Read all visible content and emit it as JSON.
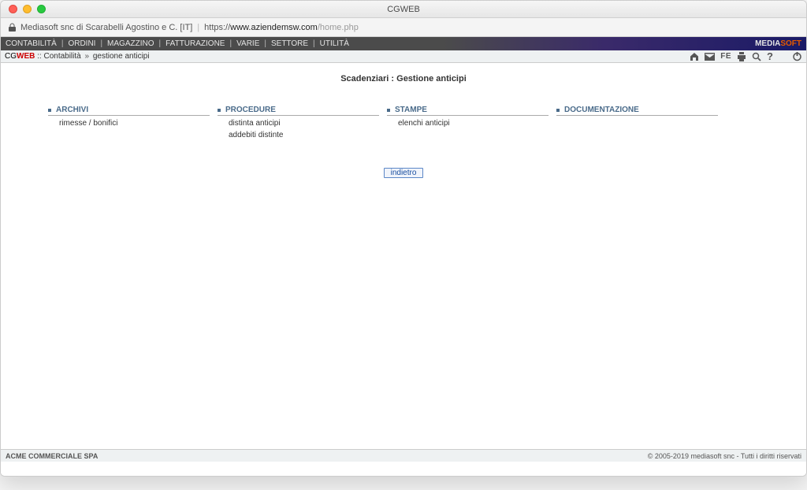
{
  "window": {
    "title": "CGWEB"
  },
  "addressbar": {
    "site_identity": "Mediasoft snc di Scarabelli Agostino e C. [IT]",
    "url_scheme": "https://",
    "url_host": "www.aziendemsw.com",
    "url_path": "/home.php"
  },
  "menubar": {
    "items": [
      "CONTABILITÀ",
      "ORDINI",
      "MAGAZZINO",
      "FATTURAZIONE",
      "VARIE",
      "SETTORE",
      "UTILITÀ"
    ],
    "brand_pre": "MEDIA",
    "brand_post": "SOFT"
  },
  "breadcrumb": {
    "app_pre": "CG",
    "app_post": "WEB",
    "after_app": " :: ",
    "parent": "Contabilità",
    "sep": " » ",
    "current": "gestione anticipi",
    "fe_label": "FE"
  },
  "page": {
    "title": "Scadenziari : Gestione anticipi",
    "back_label": "indietro"
  },
  "columns": [
    {
      "heading": "ARCHIVI",
      "items": [
        "rimesse / bonifici"
      ]
    },
    {
      "heading": "PROCEDURE",
      "items": [
        "distinta anticipi",
        "addebiti distinte"
      ]
    },
    {
      "heading": "STAMPE",
      "items": [
        "elenchi anticipi"
      ]
    },
    {
      "heading": "DOCUMENTAZIONE",
      "items": []
    }
  ],
  "footer": {
    "company": "ACME COMMERCIALE SPA",
    "copyright": "© 2005-2019 mediasoft snc - Tutti i diritti riservati"
  }
}
